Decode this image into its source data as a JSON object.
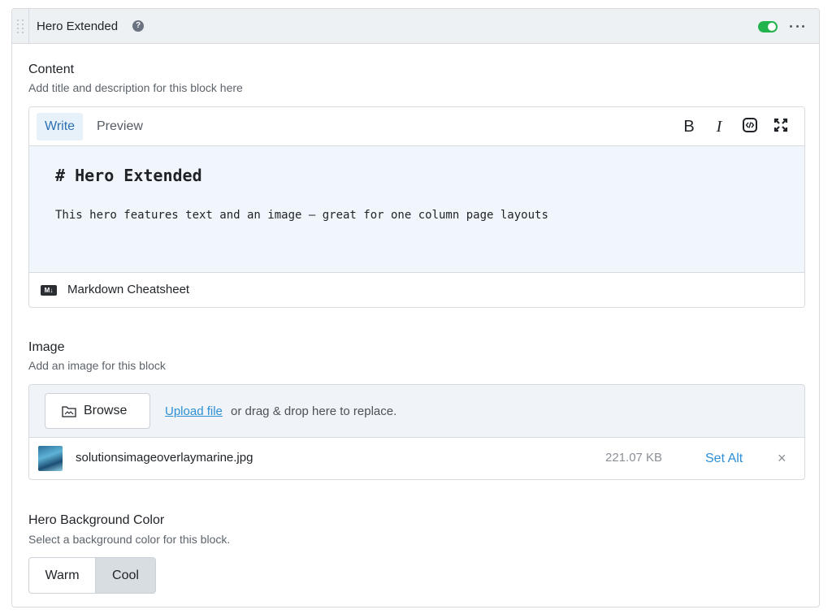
{
  "block": {
    "title": "Hero Extended",
    "help_icon": "question-circle-icon",
    "toggle_on": true,
    "accent_color": "#22b34c"
  },
  "content": {
    "title": "Content",
    "subtitle": "Add title and description for this block here",
    "tabs": [
      {
        "label": "Write",
        "active": true
      },
      {
        "label": "Preview",
        "active": false
      }
    ],
    "tools": {
      "bold": "B",
      "italic": "I",
      "code_icon": "code-icon",
      "fullscreen_icon": "fullscreen-icon"
    },
    "markdown": {
      "heading": "# Hero Extended",
      "body": "This hero features text and an image – great for one column page layouts"
    },
    "cheatsheet_label": "Markdown Cheatsheet"
  },
  "image": {
    "title": "Image",
    "subtitle": "Add an image for this block",
    "browse_label": "Browse",
    "upload_link": "Upload file",
    "upload_rest": "or drag & drop here to replace.",
    "file": {
      "name": "solutionsimageoverlaymarine.jpg",
      "size": "221.07 KB",
      "set_alt_label": "Set Alt",
      "remove_symbol": "×"
    }
  },
  "background": {
    "title": "Hero Background Color",
    "subtitle": "Select a background color for this block.",
    "options": [
      {
        "label": "Warm",
        "selected": false
      },
      {
        "label": "Cool",
        "selected": true
      }
    ]
  }
}
